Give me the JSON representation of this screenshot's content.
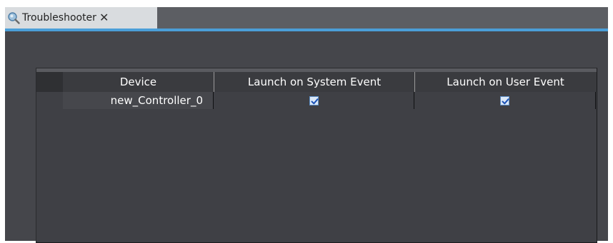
{
  "tab": {
    "title": "Troubleshooter",
    "close_glyph": "✕",
    "icon": "troubleshooter-icon"
  },
  "colors": {
    "accent": "#4b9fd8",
    "panel_bg": "#45464b",
    "tab_bg": "#d9dcdf",
    "checkbox_check": "#1a52b8"
  },
  "grid": {
    "columns": [
      "Device",
      "Launch on System Event",
      "Launch on User Event"
    ],
    "rows": [
      {
        "device": "new_Controller_0",
        "launch_on_system_event": true,
        "launch_on_user_event": true
      }
    ]
  }
}
